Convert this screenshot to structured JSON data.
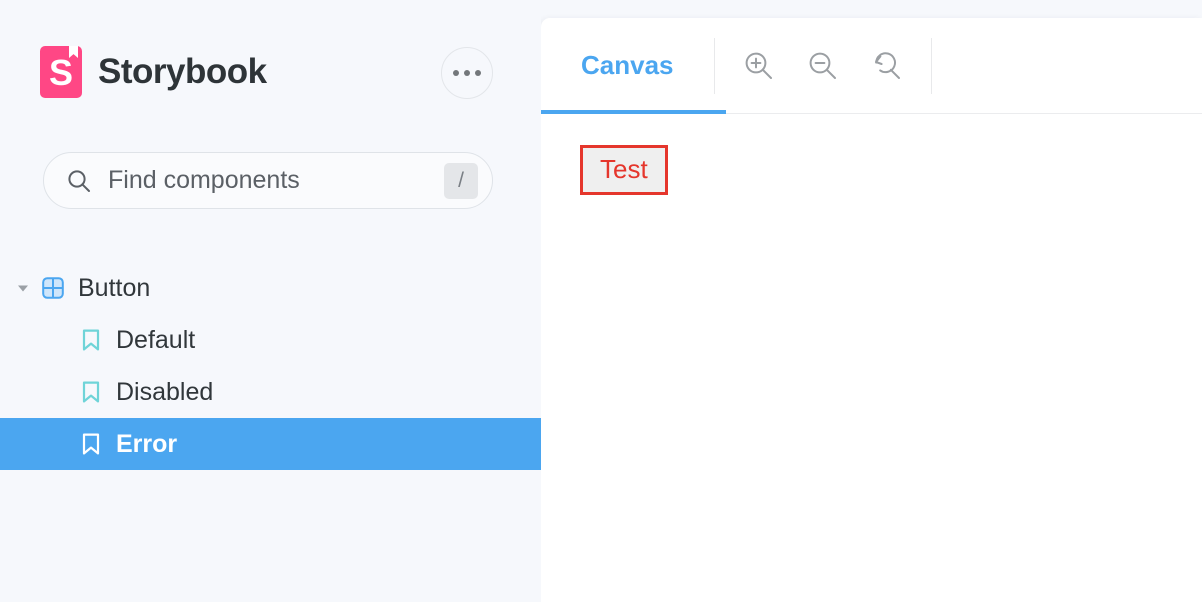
{
  "sidebar": {
    "brand": {
      "title": "Storybook",
      "logo_icon": "storybook-logo-icon",
      "logo_color": "#FF4785",
      "logo_letter": "S"
    },
    "menu_button": {
      "icon": "ellipsis-icon",
      "label": "..."
    },
    "search": {
      "icon": "search-icon",
      "placeholder": "Find components",
      "value": "",
      "shortcut": "/"
    },
    "tree": [
      {
        "label": "Button",
        "type": "component",
        "icon": "component-grid-icon",
        "icon_color": "#4BA6F0",
        "expanded": true,
        "chevron": "chevron-down-icon",
        "selected": false
      },
      {
        "label": "Default",
        "type": "story",
        "icon": "bookmark-icon",
        "icon_color": "#6FD4D8",
        "selected": false
      },
      {
        "label": "Disabled",
        "type": "story",
        "icon": "bookmark-icon",
        "icon_color": "#6FD4D8",
        "selected": false
      },
      {
        "label": "Error",
        "type": "story",
        "icon": "bookmark-icon",
        "icon_color": "#FFFFFF",
        "selected": true
      }
    ],
    "selection_color": "#4BA6F0"
  },
  "main": {
    "tabs": [
      {
        "label": "Canvas",
        "active": true,
        "accent_color": "#4BA6F0"
      }
    ],
    "tools": [
      {
        "name": "zoom-in",
        "icon": "zoom-in-icon"
      },
      {
        "name": "zoom-out",
        "icon": "zoom-out-icon"
      },
      {
        "name": "zoom-reset",
        "icon": "zoom-reset-icon"
      }
    ],
    "canvas": {
      "story_button": {
        "label": "Test",
        "text_color": "#E5362C",
        "border_color": "#E5362C",
        "background_color": "#EFEFEF"
      }
    }
  }
}
